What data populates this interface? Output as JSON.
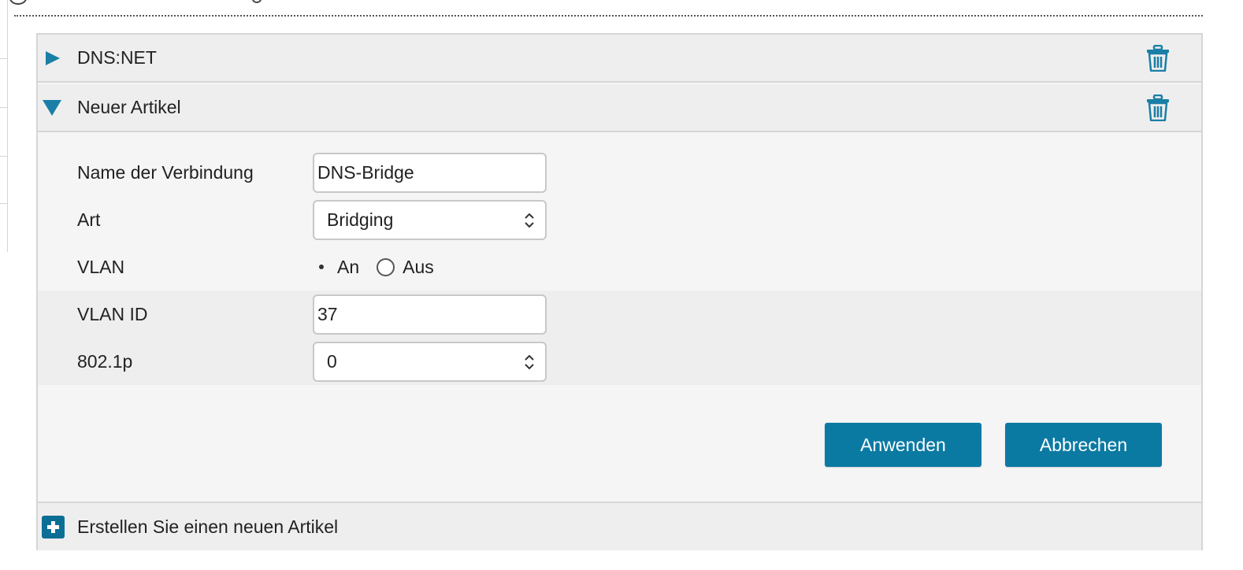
{
  "accordion": {
    "items": [
      {
        "label": "DNS:NET",
        "expanded": false,
        "icon": "triangle-right-icon"
      },
      {
        "label": "Neuer Artikel",
        "expanded": true,
        "icon": "triangle-down-icon"
      }
    ],
    "delete_icon": "trash-icon",
    "accent_color": "#1a7fa6"
  },
  "form": {
    "connection_name": {
      "label": "Name der Verbindung",
      "value": "DNS-Bridge"
    },
    "type": {
      "label": "Art",
      "selected": "Bridging"
    },
    "vlan": {
      "label": "VLAN",
      "options": [
        "An",
        "Aus"
      ],
      "selected": "An"
    },
    "vlan_id": {
      "label": "VLAN ID",
      "value": "37"
    },
    "priority": {
      "label": "802.1p",
      "selected": "0"
    }
  },
  "actions": {
    "apply_label": "Anwenden",
    "cancel_label": "Abbrechen",
    "button_color": "#0b7aa3"
  },
  "add_item": {
    "label": "Erstellen Sie einen neuen Artikel",
    "icon": "plus-icon"
  }
}
